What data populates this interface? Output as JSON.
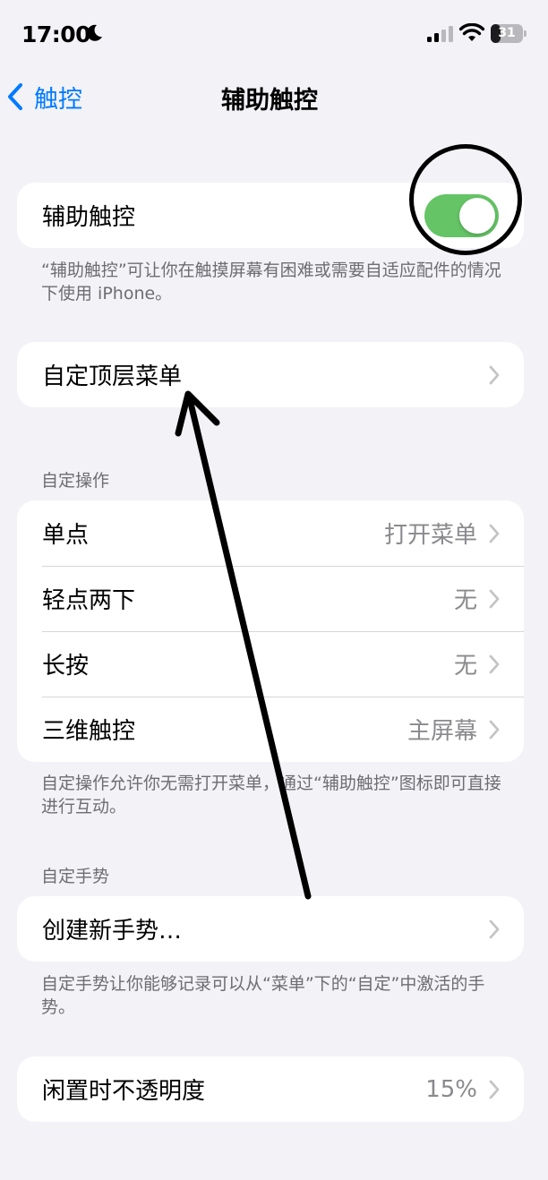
{
  "status_bar": {
    "time": "17:00",
    "battery_level": "31",
    "battery_fraction": 0.31,
    "icons": [
      "moon-icon",
      "signal-icon",
      "wifi-icon",
      "battery-icon"
    ]
  },
  "nav": {
    "back_label": "触控",
    "title": "辅助触控"
  },
  "assistive_touch": {
    "label": "辅助触控",
    "enabled": true,
    "note": "“辅助触控”可让你在触摸屏幕有困难或需要自适应配件的情况下使用 iPhone。"
  },
  "top_menu": {
    "label": "自定顶层菜单"
  },
  "custom_actions": {
    "header": "自定操作",
    "items": [
      {
        "label": "单点",
        "value": "打开菜单"
      },
      {
        "label": "轻点两下",
        "value": "无"
      },
      {
        "label": "长按",
        "value": "无"
      },
      {
        "label": "三维触控",
        "value": "主屏幕"
      }
    ],
    "note": "自定操作允许你无需打开菜单，通过“辅助触控”图标即可直接进行互动。"
  },
  "custom_gestures": {
    "header": "自定手势",
    "create_label": "创建新手势…",
    "note": "自定手势让你能够记录可以从“菜单”下的“自定”中激活的手势。"
  },
  "idle_opacity": {
    "label": "闲置时不透明度",
    "value": "15%"
  },
  "colors": {
    "accent": "#007aff",
    "toggle_on": "#65c466",
    "background": "#f2f2f7"
  }
}
